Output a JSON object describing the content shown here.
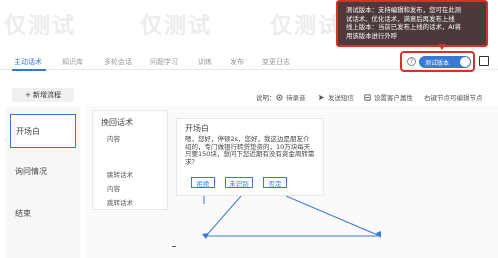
{
  "tooltip": {
    "line1": "测试版本：支持编辑和发布，您可在此测",
    "line2": "试话术、优化话术，满意后再发布上线",
    "line3": "线上版本：当前已发布上线的话术，AI将",
    "line4": "用该版本进行外呼"
  },
  "tabs": [
    {
      "label": "主动话术",
      "active": true
    },
    {
      "label": "知识库",
      "active": false
    },
    {
      "label": "多轮会话",
      "active": false
    },
    {
      "label": "问题学习",
      "active": false
    },
    {
      "label": "训练",
      "active": false
    },
    {
      "label": "发布",
      "active": false
    },
    {
      "label": "变更日志",
      "active": false
    }
  ],
  "toggle": {
    "label": "测试版本",
    "help": "?"
  },
  "toolbar": {
    "new_flow": "+ 新增流程"
  },
  "legend": {
    "prefix": "说明：",
    "items": [
      "待录音",
      "发送短信",
      "设置客户属性",
      "右键节点可编辑节点"
    ]
  },
  "sidebar": {
    "items": [
      "开场白",
      "询问情况",
      "结束"
    ]
  },
  "cards": {
    "left_title": "挽回话术",
    "left_sub1": "内容",
    "left_title2": "跳转话术",
    "left_sub2": "内容",
    "left_sub3": "跳转话术"
  },
  "node": {
    "title": "开场白",
    "text": "嗯，您好，停顿2s，您好，我这边是朋友介绍的，专门做银行转贷垫资的，10万块每天只要150块，想问下您近期有没有资金周转需求？",
    "keywords": [
      "拒绝",
      "未识别",
      "否定"
    ]
  },
  "watermark": "仅测试",
  "colors": {
    "accent": "#3a78d6",
    "alert": "#d9302a",
    "tooltip_bg": "#4a3a3a"
  }
}
